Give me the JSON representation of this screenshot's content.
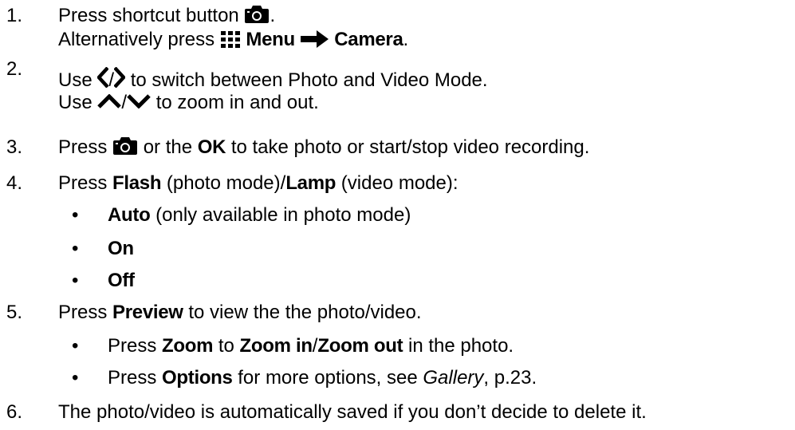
{
  "steps": [
    {
      "number": "1.",
      "line1": {
        "text_a": "Press shortcut button",
        "icon": "camera-icon",
        "text_b": "."
      },
      "line2": {
        "text_a": "Alternatively press",
        "menu_icon": "grid-menu-icon",
        "menu_label": "Menu",
        "arrow_icon": "arrow-right-icon",
        "camera_label": "Camera",
        "text_b": "."
      }
    },
    {
      "number": "2.",
      "line1": {
        "text_a": "Use",
        "left_icon": "chevron-left-icon",
        "slash": "/",
        "right_icon": "chevron-right-icon",
        "text_b": "to switch between Photo and Video Mode."
      },
      "line2": {
        "text_a": "Use",
        "up_icon": "chevron-up-icon",
        "slash": "/",
        "down_icon": "chevron-down-icon",
        "text_b": "to zoom in and out."
      }
    },
    {
      "number": "3.",
      "line1": {
        "text_a": "Press",
        "icon": "camera-icon",
        "text_b": "or the",
        "ok_label": "OK",
        "text_c": "to take photo or start/stop video recording."
      }
    },
    {
      "number": "4.",
      "line1": {
        "text_a": "Press",
        "flash_label": "Flash",
        "text_b": "(photo mode)/",
        "lamp_label": "Lamp",
        "text_c": "(video mode):"
      },
      "bullets": [
        {
          "label": "Auto",
          "note": "(only available in photo mode)"
        },
        {
          "label": "On",
          "note": ""
        },
        {
          "label": "Off",
          "note": ""
        }
      ]
    },
    {
      "number": "5.",
      "line1": {
        "text_a": "Press",
        "preview_label": "Preview",
        "text_b": "to view the the photo/video."
      },
      "bullets": [
        {
          "text_a": "Press",
          "zoom_label": "Zoom",
          "text_b": "to",
          "zoom_in_label": "Zoom in",
          "slash": "/",
          "zoom_out_label": "Zoom out",
          "text_c": "in the photo."
        },
        {
          "text_a": "Press",
          "options_label": "Options",
          "text_b": "for more options, see",
          "gallery_label": "Gallery",
          "text_c": ", p.23."
        }
      ]
    },
    {
      "number": "6.",
      "line1": {
        "text_a": "The photo/video is automatically saved if you don’t decide to delete it."
      }
    }
  ],
  "bullet_char": "•"
}
